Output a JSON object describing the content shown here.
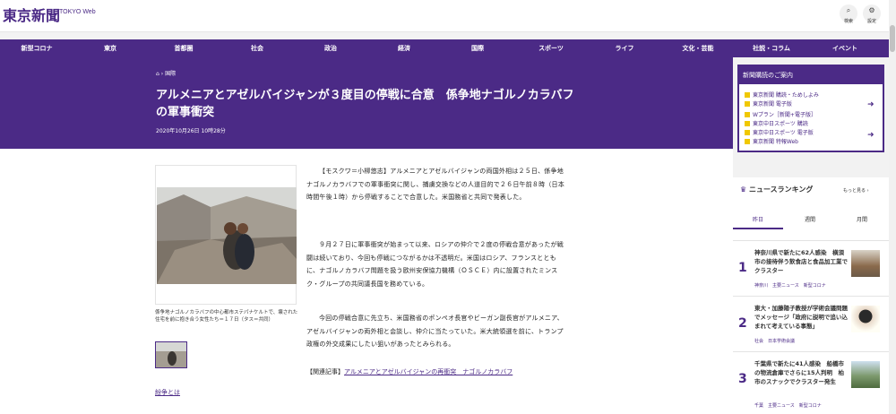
{
  "site": {
    "logo": "東京新聞",
    "logo_web": "TOKYO Web"
  },
  "top_icons": [
    {
      "label": "検索",
      "icon": "search-icon"
    },
    {
      "label": "設定",
      "icon": "gear-icon"
    }
  ],
  "nav": [
    "新型コロナ",
    "東京",
    "首都圏",
    "社会",
    "政治",
    "経済",
    "国際",
    "スポーツ",
    "ライフ",
    "文化・芸能",
    "社説・コラム",
    "イベント"
  ],
  "article": {
    "breadcrumb": "国際",
    "headline": "アルメニアとアゼルバイジャンが３度目の停戦に合意　係争地ナゴルノカラバフの軍事衝突",
    "date": "2020年10月26日 10時28分",
    "caption": "係争地ナゴルノカラバフの中心都市ステパナケルトで、壊された住宅を前に抱き合う女性たち＝１７日（タス＝共同）",
    "paragraphs": [
      "【モスクワ＝小柳悠志】アルメニアとアゼルバイジャンの両国外相は２５日、係争地ナゴルノカラバフでの軍事衝突に関し、捕虜交換などの人道目的で２６日午前８時（日本時間午後１時）から停戦することで合意した。米国務省と共同で発表した。",
      "９月２７日に軍事衝突が始まって以来、ロシアの仲介で２度の停戦合意があったが戦闘は続いており、今回も停戦につながるかは不透明だ。米国はロシア、フランスとともに、ナゴルノカラバフ問題を扱う欧州安保協力機構（ＯＳＣＥ）内に設置されたミンスク・グループの共同議長国を務めている。",
      "今回の停戦合意に先立ち、米国務省のポンペオ長官やビーガン副長官がアルメニア、アゼルバイジャンの両外相と会談し、仲介に当たっていた。米大統領選を前に、トランプ政権の外交成果にしたい狙いがあったとみられる。"
    ],
    "related_label": "【関連記事】",
    "related_link": "アルメニアとアゼルバイジャンの再衝突　ナゴルノカラバフ",
    "funso_link": "紛争とは"
  },
  "promo": {
    "title": "新聞購読のご案内",
    "items": [
      "東京新聞 購読・ためしよみ",
      "東京新聞 電子版",
      "Wプラン［新聞+電子版］",
      "東京中日スポーツ 購読",
      "東京中日スポーツ 電子版",
      "東京新聞 特報Web"
    ]
  },
  "ranking": {
    "title": "ニュースランキング",
    "more": "もっと見る",
    "tabs": [
      "昨日",
      "週間",
      "月間"
    ],
    "active_tab": 0,
    "items": [
      {
        "num": "1",
        "text": "神奈川県で新たに62人感染　横須市の接待伴う飲食店と食品加工業でクラスター",
        "tags": "神奈川　主要ニュース　新型コロナ"
      },
      {
        "num": "2",
        "text": "東大・加藤陽子教授が学術会議問題でメッセージ「政府に説明で追い込まれて考えている事態」",
        "tags": "社会　日本学術会議"
      },
      {
        "num": "3",
        "text": "千葉県で新たに41人感染　船橋市の物流倉庫でさらに15人判明　柏市のスナックでクラスター発生",
        "tags": "千葉　主要ニュース　新型コロナ"
      }
    ]
  }
}
